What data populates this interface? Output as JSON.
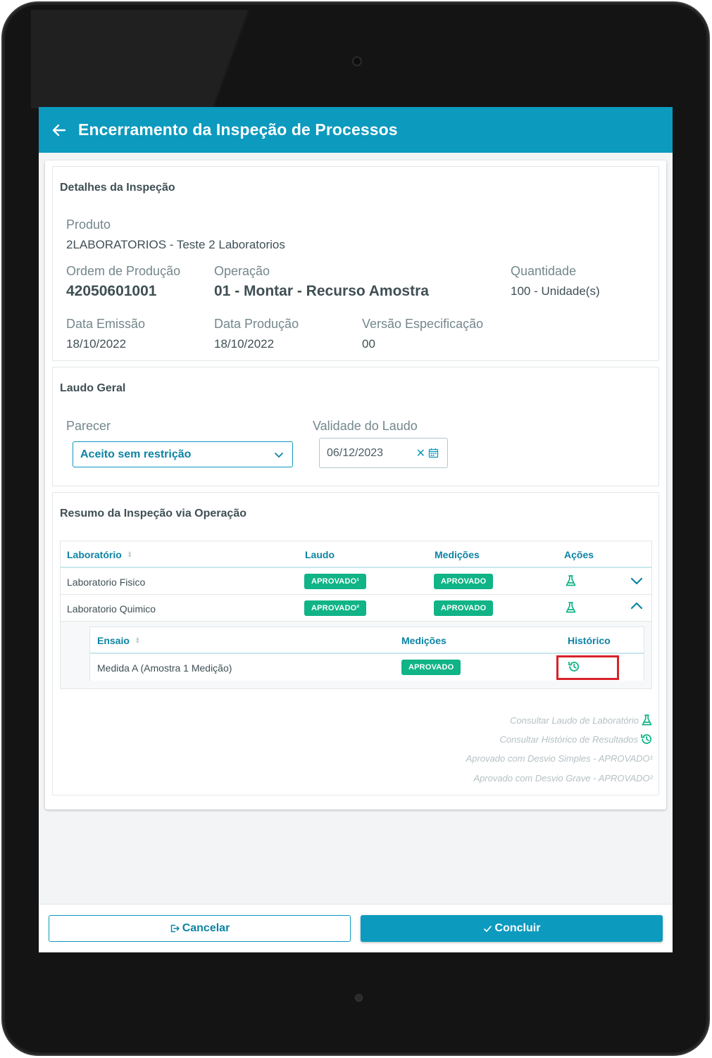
{
  "header": {
    "title": "Encerramento da Inspeção de Processos"
  },
  "details": {
    "section_title": "Detalhes da Inspeção",
    "produto_label": "Produto",
    "produto_value": "2LABORATORIOS - Teste 2 Laboratorios",
    "ordem_label": "Ordem de Produção",
    "ordem_value": "42050601001",
    "operacao_label": "Operação",
    "operacao_value": "01 - Montar - Recurso Amostra",
    "quantidade_label": "Quantidade",
    "quantidade_value": "100 - Unidade(s)",
    "emissao_label": "Data Emissão",
    "emissao_value": "18/10/2022",
    "producao_label": "Data Produção",
    "producao_value": "18/10/2022",
    "versao_label": "Versão Especificação",
    "versao_value": "00"
  },
  "laudo": {
    "section_title": "Laudo Geral",
    "parecer_label": "Parecer",
    "parecer_value": "Aceito sem restrição",
    "validade_label": "Validade do Laudo",
    "validade_value": "06/12/2023"
  },
  "resumo": {
    "section_title": "Resumo da Inspeção via Operação",
    "columns": {
      "laboratorio": "Laboratório",
      "laudo": "Laudo",
      "medicoes": "Medições",
      "acoes": "Ações"
    },
    "rows": [
      {
        "laboratorio": "Laboratorio Fisico",
        "laudo": "APROVADO¹",
        "medicoes": "APROVADO"
      },
      {
        "laboratorio": "Laboratorio Quimico",
        "laudo": "APROVADO²",
        "medicoes": "APROVADO"
      }
    ],
    "sub": {
      "columns": {
        "ensaio": "Ensaio",
        "medicoes": "Medições",
        "historico": "Histórico"
      },
      "rows": [
        {
          "ensaio": "Medida A (Amostra 1 Medição)",
          "medicoes": "APROVADO"
        }
      ]
    },
    "legend": {
      "laudo": "Consultar Laudo de Laboratório",
      "historico": "Consultar Histórico de Resultados",
      "desvio_simples": "Aprovado com Desvio Simples - APROVADO¹",
      "desvio_grave": "Aprovado com Desvio Grave - APROVADO²"
    }
  },
  "footer": {
    "cancel_label": "Cancelar",
    "ok_label": "Concluir"
  },
  "colors": {
    "primary": "#0c9abe",
    "success": "#10b486",
    "highlight": "#d8232a"
  },
  "icons": [
    "arrow-left-icon",
    "chevron-down-icon",
    "calendar-icon",
    "close-icon",
    "flask-icon",
    "chevron-up-icon",
    "history-icon",
    "exit-icon",
    "check-icon"
  ]
}
